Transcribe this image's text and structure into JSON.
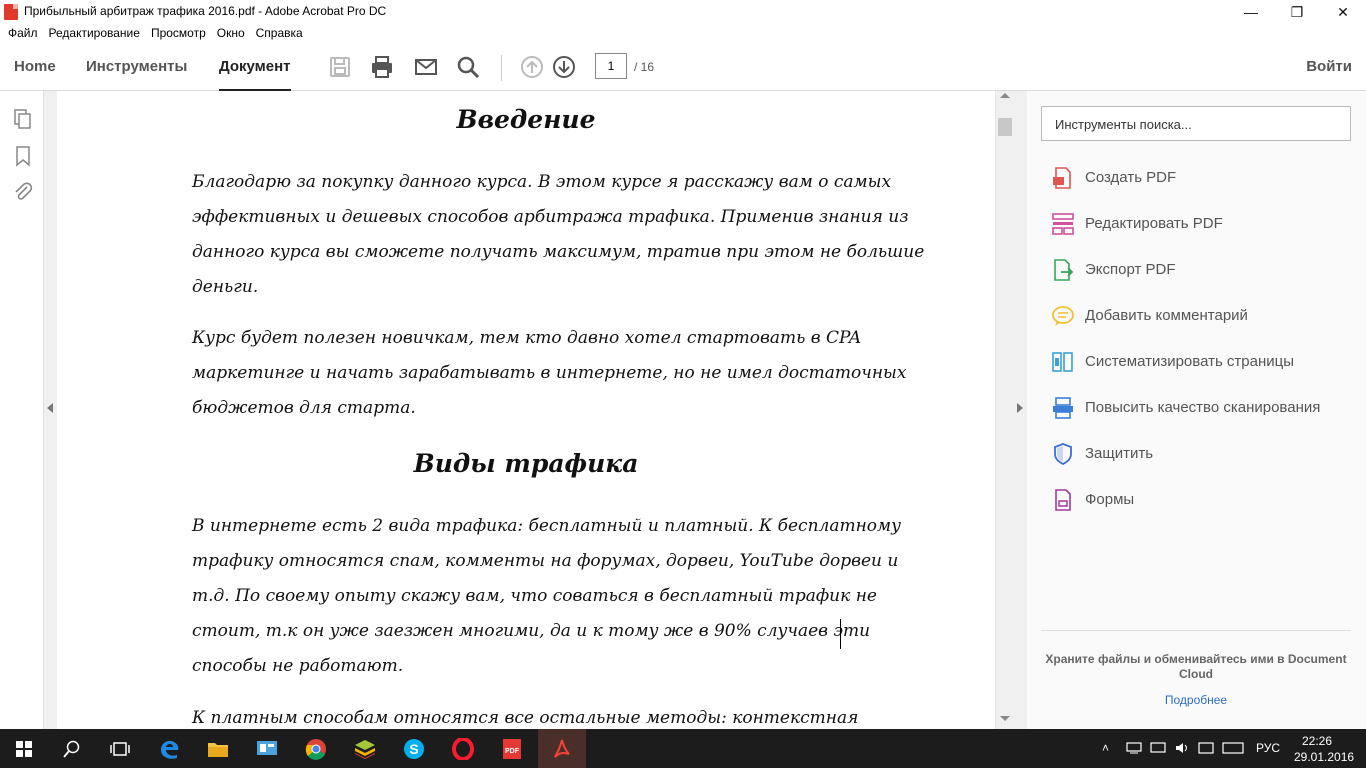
{
  "window": {
    "title": "Прибыльный арбитраж трафика 2016.pdf - Adobe Acrobat Pro DC",
    "minimize": "—",
    "maximize": "❐",
    "close": "✕"
  },
  "menu": [
    "Файл",
    "Редактирование",
    "Просмотр",
    "Окно",
    "Справка"
  ],
  "toolbar": {
    "tabs": [
      "Home",
      "Инструменты",
      "Документ"
    ],
    "active_tab": "Документ",
    "page_current": "1",
    "page_total": "/ 16",
    "login": "Войти",
    "icons": [
      "save-icon",
      "print-icon",
      "mail-icon",
      "search-icon",
      "page-up-icon",
      "page-down-icon"
    ]
  },
  "document": {
    "heading1": "Введение",
    "para1": "Благодарю за покупку данного курса. В этом курсе я расскажу вам о самых эффективных и дешевых способов арбитража трафика. Применив знания из данного курса вы сможете получать максимум, тратив при этом не большие деньги.",
    "para2": "Курс будет полезен новичкам, тем кто давно хотел стартовать в CPA маркетинге и начать зарабатывать в интернете, но не имел достаточных бюджетов для старта.",
    "heading2": "Виды трафика",
    "para3": "В интернете есть 2 вида трафика: бесплатный и платный. К бесплатному трафику относятся спам, комменты на форумах, дорвеи, YouTube дорвеи и т.д. По своему опыту скажу вам, что соваться в бесплатный трафик не стоит, т.к он уже заезжен многими, да и к тому же в 90% случаев эти способы не работают.",
    "para4": "К платным способам относятся все остальные методы: контекстная"
  },
  "tools_pane": {
    "search_placeholder": "Инструменты поиска...",
    "items": [
      {
        "label": "Создать PDF",
        "icon": "create-pdf-icon",
        "color": "#e0574f"
      },
      {
        "label": "Редактировать PDF",
        "icon": "edit-pdf-icon",
        "color": "#d0529a"
      },
      {
        "label": "Экспорт PDF",
        "icon": "export-pdf-icon",
        "color": "#3aa55a"
      },
      {
        "label": "Добавить комментарий",
        "icon": "comment-icon",
        "color": "#f2c12e"
      },
      {
        "label": "Систематизировать страницы",
        "icon": "organize-pages-icon",
        "color": "#3aa0d8"
      },
      {
        "label": "Повысить качество сканирования",
        "icon": "enhance-scan-icon",
        "color": "#3a7fd8"
      },
      {
        "label": "Защитить",
        "icon": "protect-icon",
        "color": "#3a6fd8"
      },
      {
        "label": "Формы",
        "icon": "forms-icon",
        "color": "#a03aa0"
      }
    ],
    "cloud_text": "Храните файлы и обменивайтесь ими в Document Cloud",
    "cloud_link": "Подробнее"
  },
  "taskbar": {
    "apps": [
      "start-icon",
      "cortana-search-icon",
      "task-view-icon",
      "edge-icon",
      "file-explorer-icon",
      "control-panel-icon",
      "chrome-icon",
      "bluestacks-icon",
      "skype-icon",
      "opera-icon",
      "pdf-reader-icon",
      "acrobat-icon"
    ],
    "language": "РУС",
    "time": "22:26",
    "date": "29.01.2016"
  }
}
